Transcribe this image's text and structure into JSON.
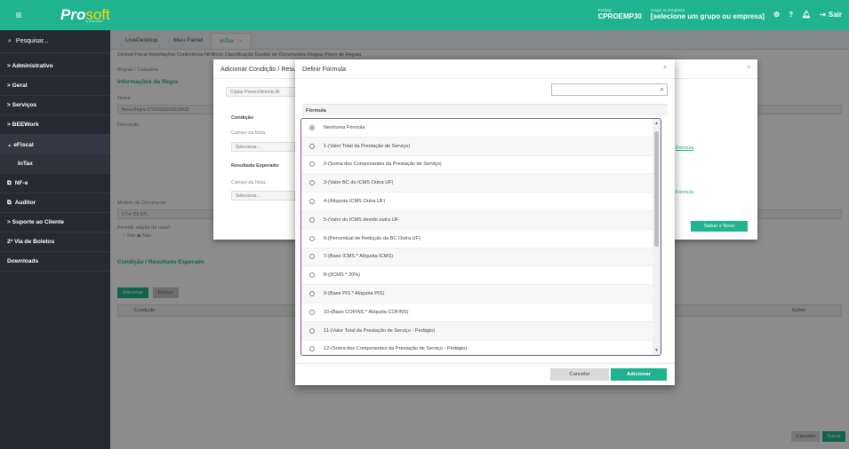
{
  "app": {
    "logo": "Pro",
    "logo_soft": "soft",
    "logo_sub": "by elcometech"
  },
  "topbar": {
    "prolimp_label": "Prolimp",
    "prolimp_value": "CPROEMP30",
    "grupo_label": "Grupo ou Empresa",
    "grupo_value": "[selecione um grupo ou empresa]",
    "sair": "Sair"
  },
  "sidebar": {
    "search": "Pesquisar...",
    "items": [
      {
        "label": "> Administrativo"
      },
      {
        "label": "> Geral"
      },
      {
        "label": "> Serviços"
      },
      {
        "label": "> BEEWork"
      },
      {
        "label": "⌄ eFiscal"
      },
      {
        "label": "InTax"
      },
      {
        "label": "NF-e"
      },
      {
        "label": "Auditor"
      },
      {
        "label": "> Suporte ao Cliente"
      },
      {
        "label": "2ª Via de Boletos"
      },
      {
        "label": "Downloads"
      }
    ]
  },
  "tabs": [
    {
      "label": "LiveDesktop"
    },
    {
      "label": "Meu Painel"
    },
    {
      "label": "InTax"
    }
  ],
  "background": {
    "crumbs": "Central Fiscal   Importações   Conferência NFBloco   Classificação   Gestão de Documentos   Regras   Plano de Regras",
    "back": "Regras / Cadastrar",
    "info_title": "Informações da Regra",
    "name_label": "Nome",
    "name_value": "Nova Regra 17102023151016413",
    "desc_label": "Descrição",
    "model_label": "Modelo de Documento",
    "model_value": "CT-e (55,67)",
    "permit_label": "Permitir edição da nota?",
    "permit_value": "○ Sim  ◉ Não",
    "cond_title": "Condição / Resultado Esperado",
    "btn_add": "Adicionar",
    "btn_exclude": "Excluir",
    "col_condicao": "Condição",
    "col_acoes": "Ações",
    "btn_cancelar": "Cancelar",
    "btn_salvar": "Salvar"
  },
  "modal_mid": {
    "title": "Adicionar Condição / Resultado Esperado",
    "copy": "Copiar Preenchimento Ar",
    "condicao": "Condição",
    "campo_nota": "Campo da Nota",
    "selecionar": "Selecionar...",
    "resultado": "Resultado Esperado",
    "campo_nota2": "Campo da Nota",
    "selecionar2": "Selecionar...",
    "formula_link": "Fórmula",
    "formula_link2": "Fórmula",
    "salvar_novo": "Salvar e Novo"
  },
  "modal": {
    "title": "Definir Fórmula",
    "close": "×",
    "search_placeholder": "",
    "column_header": "Fórmula",
    "options": [
      {
        "label": "Nenhuma Fórmula",
        "selected": true
      },
      {
        "label": "1-(Valor Total da Prestação de Serviço)",
        "selected": false
      },
      {
        "label": "2-(Soma dos Componentes da Prestação de Serviço)",
        "selected": false
      },
      {
        "label": "3-(Valor BC do ICMS Outra UF)",
        "selected": false
      },
      {
        "label": "4-(Alíquota ICMS Outra UF)",
        "selected": false
      },
      {
        "label": "5-(Valor do ICMS devido outra UF",
        "selected": false
      },
      {
        "label": "6-(Percentual de Redução da BC Outra UF)",
        "selected": false
      },
      {
        "label": "7-(Base ICMS * Alíquota ICMS)",
        "selected": false
      },
      {
        "label": "8-((ICMS * 20%)",
        "selected": false
      },
      {
        "label": "9-(Base PIS * Alíquota PIS)",
        "selected": false
      },
      {
        "label": "10-(Base COFINS * Alíquota COFINS)",
        "selected": false
      },
      {
        "label": "11-(Valor Total da Prestação de Serviço - Pedágio)",
        "selected": false
      },
      {
        "label": "12-(Soma dos Componentes da Prestação de Serviço - Pedágio)",
        "selected": false
      }
    ],
    "cancel": "Cancelar",
    "add": "Adicionar"
  }
}
